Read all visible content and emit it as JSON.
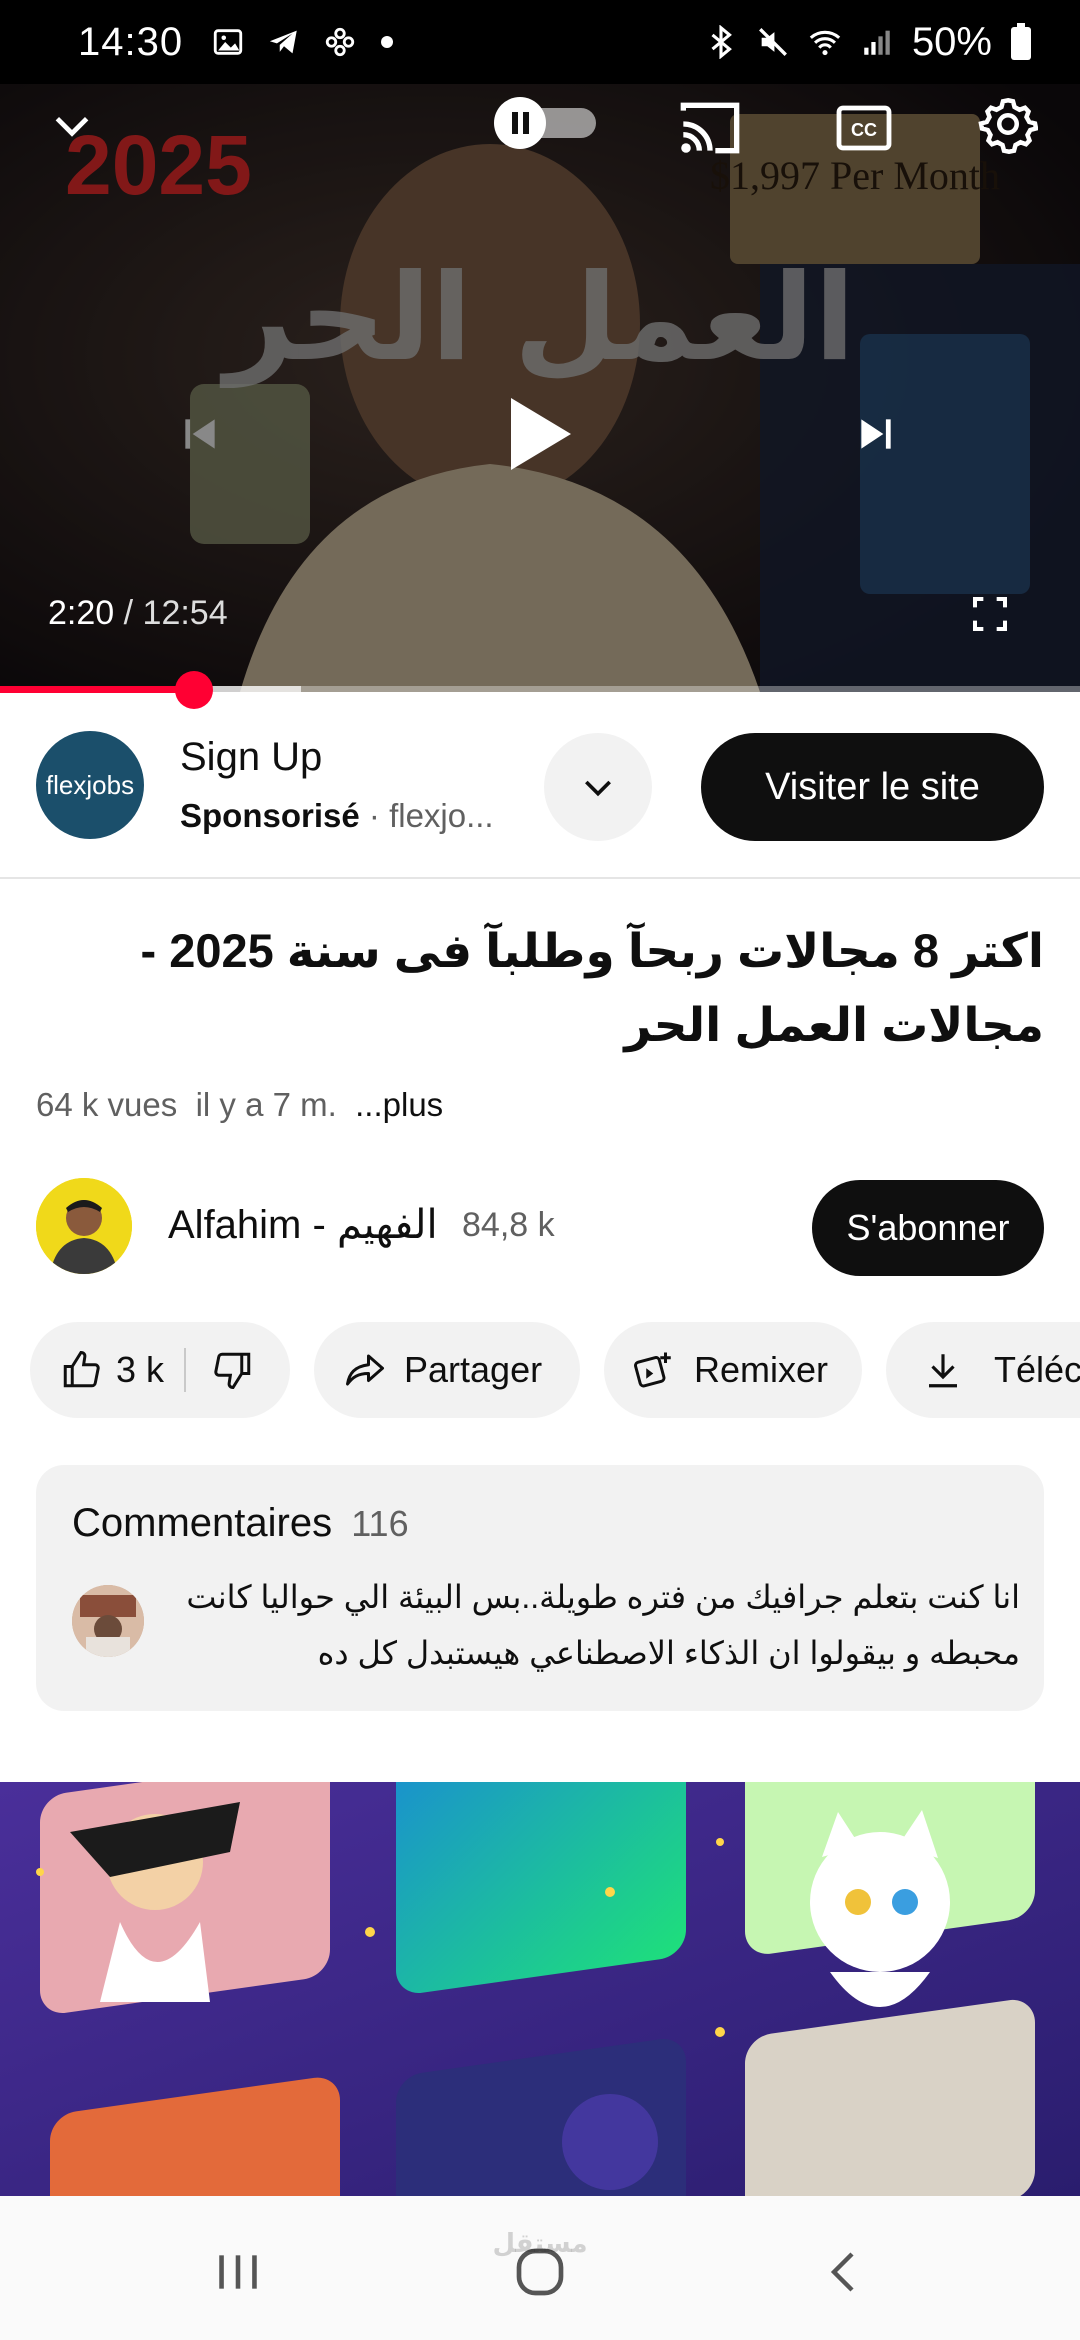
{
  "status_bar": {
    "time": "14:30",
    "battery": "50%",
    "left_icons": [
      "image-icon",
      "telegram-icon",
      "pinwheel-icon",
      "dot-icon"
    ],
    "right_icons": [
      "bluetooth-icon",
      "mute-icon",
      "wifi-icon",
      "signal-icon",
      "battery-icon"
    ]
  },
  "player": {
    "current_time": "2:20",
    "separator": "/",
    "duration": "12:54",
    "played_fraction": 0.18,
    "buffered_fraction": 0.279,
    "autoplay_state": "on",
    "thumbnail_text": {
      "year": "2025",
      "headline": "العمل الحر",
      "sign": "$1,997 Per Month"
    },
    "icons": [
      "collapse-chevron-icon",
      "autoplay-toggle-icon",
      "cast-icon",
      "captions-icon",
      "settings-icon",
      "previous-icon",
      "play-icon",
      "next-icon",
      "fullscreen-icon"
    ]
  },
  "sponsor": {
    "logo_text": "flexjobs",
    "title": "Sign Up",
    "label": "Sponsorisé",
    "dot": "·",
    "domain": "flexjo...",
    "cta": "Visiter le site"
  },
  "video": {
    "title": "اكتر 8 مجالات ربحآ وطلبآ فى سنة 2025 - مجالات العمل الحر",
    "views": "64 k vues",
    "age": "il y a 7 m.",
    "more": "...plus"
  },
  "channel": {
    "name": "Alfahim - الفهيم",
    "subscribers": "84,8 k",
    "subscribe_label": "S'abonner"
  },
  "actions": {
    "likes": "3 k",
    "share": "Partager",
    "remix": "Remixer",
    "download": "Téléch"
  },
  "comments": {
    "header": "Commentaires",
    "count": "116",
    "top_comment": "انا كنت بتعلم جرافيك من فتره طويلة..بس البيئة الي حواليا كانت محبطه و بيقولوا ان الذكاء الاصطناعي هيستبدل كل ده"
  },
  "navigation": {
    "buttons": [
      "recents-icon",
      "home-icon",
      "back-icon"
    ]
  },
  "watermark": "مستقل",
  "colors": {
    "accent_red": "#ff0033",
    "button_dark": "#0f0f0f",
    "chip_bg": "#f2f2f2",
    "secondary_text": "#606060"
  }
}
